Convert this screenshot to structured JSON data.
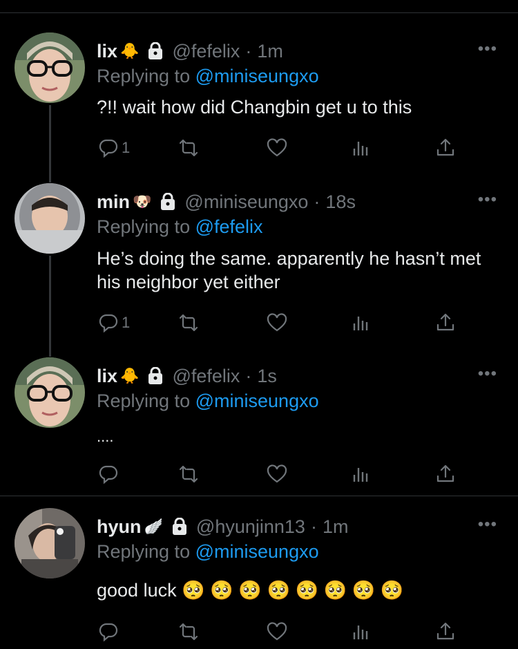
{
  "tweets": [
    {
      "name": "lix",
      "emoji": "🐥",
      "handle": "@fefelix",
      "time": "1m",
      "replying_prefix": "Replying to",
      "replying_to": "@miniseungxo",
      "text": "?!! wait how did Changbin get u to this",
      "reply_count": "1",
      "more": "•••"
    },
    {
      "name": "min",
      "emoji": "🐶",
      "handle": "@miniseungxo",
      "time": "18s",
      "replying_prefix": "Replying to",
      "replying_to": "@fefelix",
      "text": "He’s doing the same. apparently he hasn’t met his neighbor yet either",
      "reply_count": "1",
      "more": "•••"
    },
    {
      "name": "lix",
      "emoji": "🐥",
      "handle": "@fefelix",
      "time": "1s",
      "replying_prefix": "Replying to",
      "replying_to": "@miniseungxo",
      "text": "....",
      "reply_count": "",
      "more": "•••"
    },
    {
      "name": "hyun",
      "emoji": "🪽",
      "handle": "@hyunjinn13",
      "time": "1m",
      "replying_prefix": "Replying to",
      "replying_to": "@miniseungxo",
      "text": "good luck 🥺 🥺 🥺 🥺 🥺 🥺 🥺 🥺",
      "reply_count": "",
      "more": "•••"
    }
  ],
  "separator": "·",
  "icons": [
    "reply-icon",
    "retweet-icon",
    "like-icon",
    "analytics-icon",
    "share-icon",
    "lock-icon",
    "more-icon"
  ],
  "colors": {
    "background": "#000000",
    "text": "#e7e9ea",
    "muted": "#71767b",
    "link": "#1d9bf0",
    "line": "#333639"
  }
}
